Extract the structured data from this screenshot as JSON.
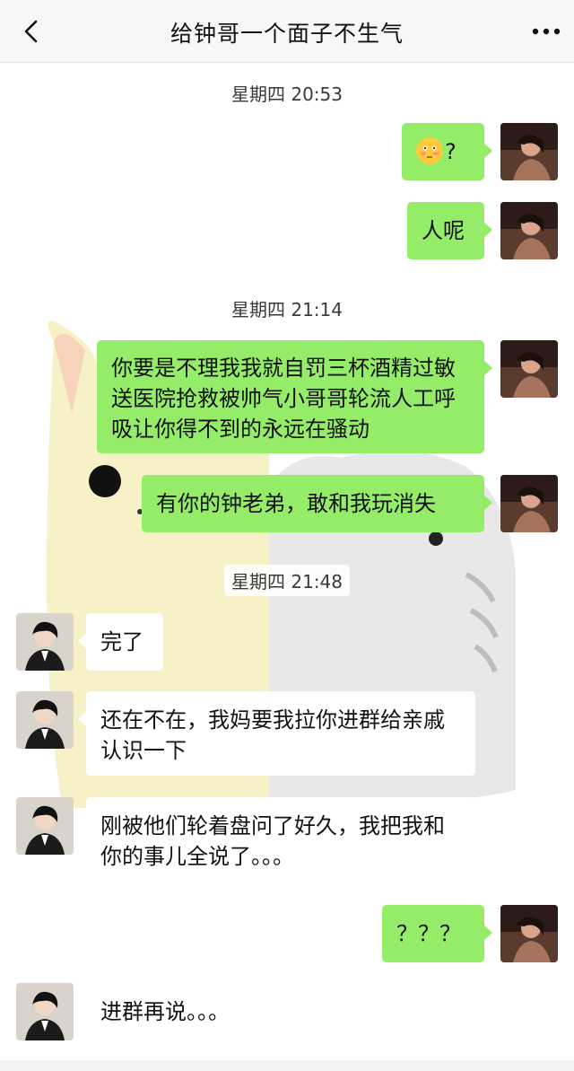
{
  "header": {
    "title": "给钟哥一个面子不生气"
  },
  "timestamps": [
    "星期四 20:53",
    "星期四 21:14",
    "星期四 21:48"
  ],
  "messages": [
    {
      "from": "me",
      "text": "?",
      "emoji": "flushed-face-emoji"
    },
    {
      "from": "me",
      "text": "人呢"
    },
    {
      "from": "me",
      "text": "你要是不理我我就自罚三杯酒精过敏送医院抢救被帅气小哥哥轮流人工呼吸让你得不到的永远在骚动"
    },
    {
      "from": "me",
      "text": "有你的钟老弟，敢和我玩消失"
    },
    {
      "from": "other",
      "text": "完了"
    },
    {
      "from": "other",
      "text": "还在不在，我妈要我拉你进群给亲戚认识一下"
    },
    {
      "from": "other",
      "text": "刚被他们轮着盘问了好久，我把我和你的事儿全说了。。。"
    },
    {
      "from": "me",
      "text": "？？？"
    },
    {
      "from": "other",
      "text": "进群再说。。。"
    }
  ],
  "colors": {
    "my_bubble": "#95ec69",
    "other_bubble": "#ffffff",
    "header_bg": "#f7f7f7"
  }
}
